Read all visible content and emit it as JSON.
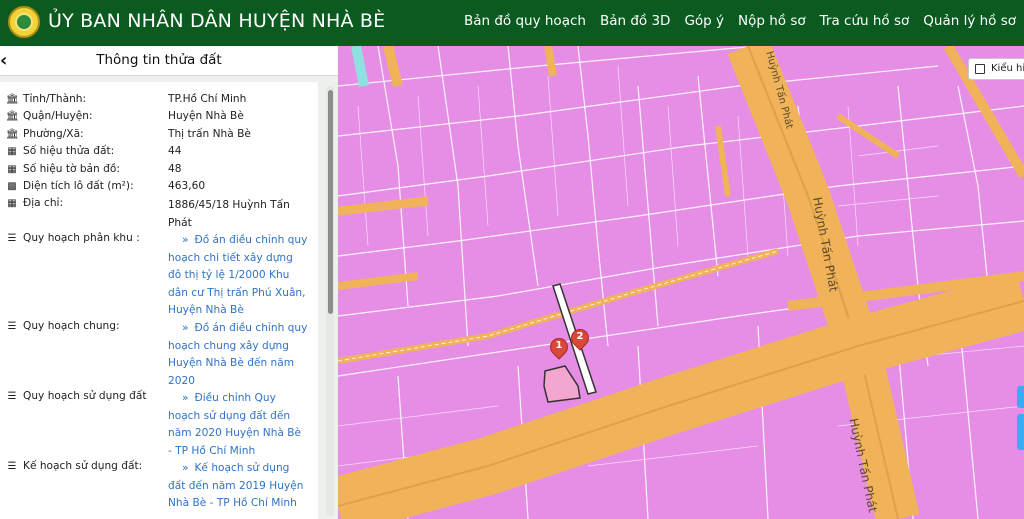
{
  "header": {
    "title": "ỦY BAN NHÂN DÂN HUYỆN NHÀ BÈ",
    "logo_icon": "emblem-icon",
    "bg_color": "#0b5a1f",
    "menu": [
      {
        "label": "Bản đồ quy hoạch"
      },
      {
        "label": "Bản đồ 3D"
      },
      {
        "label": "Góp ý"
      },
      {
        "label": "Nộp hồ sơ"
      },
      {
        "label": "Tra cứu hồ sơ"
      },
      {
        "label": "Quản lý hồ sơ"
      }
    ]
  },
  "panel": {
    "back_icon": "chevron-left-icon",
    "title": "Thông tin thửa đất",
    "fields": [
      {
        "icon": "bank-icon",
        "label": "Tỉnh/Thành:",
        "value": "TP.Hồ Chí Minh"
      },
      {
        "icon": "bank-icon",
        "label": "Quận/Huyện:",
        "value": "Huyện Nhà Bè"
      },
      {
        "icon": "bank-icon",
        "label": "Phường/Xã:",
        "value": "Thị trấn Nhà Bè"
      },
      {
        "icon": "map-icon",
        "label": "Số hiệu thửa đất:",
        "value": "44"
      },
      {
        "icon": "map-icon",
        "label": "Số hiệu tờ bản đồ:",
        "value": "48"
      },
      {
        "icon": "area-icon",
        "label": "Diện tích lô đất (m²):",
        "value": "463,60"
      },
      {
        "icon": "map-icon",
        "label": "Địa chỉ:",
        "value": "1886/45/18 Huỳnh Tấn Phát"
      }
    ],
    "plans": [
      {
        "icon": "list-icon",
        "label": "Quy hoạch phân khu :",
        "link": "Đồ án điều chỉnh quy hoạch chi tiết xây dựng đô thị tỷ lệ 1/2000 Khu dân cư Thị trấn Phú Xuân, Huyện Nhà Bè"
      },
      {
        "icon": "list-icon",
        "label": "Quy hoạch chung:",
        "link": "Đồ án điều chỉnh quy hoạch chung xây dựng Huyện Nhà Bè đến năm 2020"
      },
      {
        "icon": "list-icon",
        "label": "Quy hoạch sử dụng đất",
        "link": "Điều chỉnh Quy hoạch sử dụng đất đến năm 2020 Huyện Nhà Bè - TP Hồ Chí Minh"
      },
      {
        "icon": "list-icon",
        "label": "Kế hoạch sử dụng đất:",
        "link": "Kế hoạch sử dụng đất đến năm 2019 Huyện Nhà Bè - TP Hồ Chí Minh"
      }
    ],
    "link_arrow": "»"
  },
  "map": {
    "legend_button": "Kiểu hiển",
    "legend_icon": "book-icon",
    "roads": [
      {
        "label": "Huỳnh Tấn Phát"
      },
      {
        "label": "Huỳnh Tấn Phát"
      },
      {
        "label": "Huỳnh Tấn Phát"
      }
    ],
    "markers": [
      {
        "label": "1"
      },
      {
        "label": "2"
      }
    ],
    "colors": {
      "residential": "#e68ee6",
      "road": "#f1b35a",
      "parcel_line": "#ffffff",
      "marker": "#d9483b",
      "selected_parcel": "#f3a6d0"
    }
  }
}
